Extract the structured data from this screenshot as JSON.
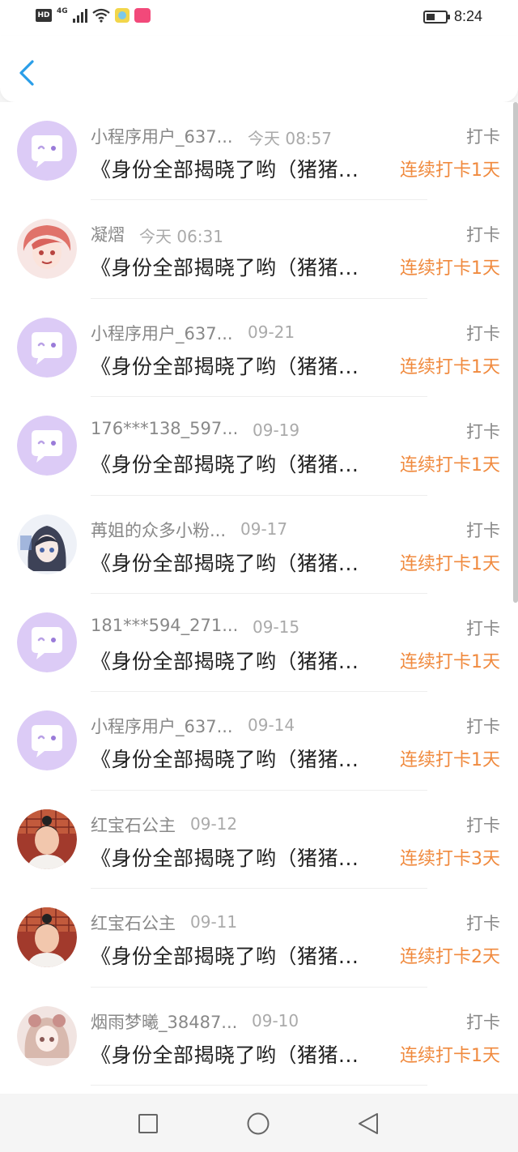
{
  "status_bar": {
    "hd": "HD",
    "network": "4G",
    "time": "8:24",
    "icons": [
      "hd-icon",
      "signal-icon",
      "wifi-icon",
      "app-notification-icon",
      "app-notification-icon-2",
      "battery-icon"
    ]
  },
  "header": {
    "back_icon": "chevron-left-icon",
    "accent": "#2a9ee8"
  },
  "colors": {
    "streak": "#f08a3e",
    "placeholder_avatar": "#d9c6f5"
  },
  "items": [
    {
      "name": "小程序用户_637...",
      "time": "今天 08:57",
      "title": "《身份全部揭晓了哟（猪猪...",
      "action": "打卡",
      "streak": "连续打卡1天",
      "avatar": "placeholder"
    },
    {
      "name": "凝熠",
      "time": "今天 06:31",
      "title": "《身份全部揭晓了哟（猪猪...",
      "action": "打卡",
      "streak": "连续打卡1天",
      "avatar": "anime-red"
    },
    {
      "name": "小程序用户_637...",
      "time": "09-21",
      "title": "《身份全部揭晓了哟（猪猪...",
      "action": "打卡",
      "streak": "连续打卡1天",
      "avatar": "placeholder"
    },
    {
      "name": "176***138_597...",
      "time": "09-19",
      "title": "《身份全部揭晓了哟（猪猪...",
      "action": "打卡",
      "streak": "连续打卡1天",
      "avatar": "placeholder"
    },
    {
      "name": "苒姐的众多小粉...",
      "time": "09-17",
      "title": "《身份全部揭晓了哟（猪猪...",
      "action": "打卡",
      "streak": "连续打卡1天",
      "avatar": "anime-blue"
    },
    {
      "name": "181***594_271...",
      "time": "09-15",
      "title": "《身份全部揭晓了哟（猪猪...",
      "action": "打卡",
      "streak": "连续打卡1天",
      "avatar": "placeholder"
    },
    {
      "name": "小程序用户_637...",
      "time": "09-14",
      "title": "《身份全部揭晓了哟（猪猪...",
      "action": "打卡",
      "streak": "连续打卡1天",
      "avatar": "placeholder"
    },
    {
      "name": "红宝石公主",
      "time": "09-12",
      "title": "《身份全部揭晓了哟（猪猪...",
      "action": "打卡",
      "streak": "连续打卡3天",
      "avatar": "photo"
    },
    {
      "name": "红宝石公主",
      "time": "09-11",
      "title": "《身份全部揭晓了哟（猪猪...",
      "action": "打卡",
      "streak": "连续打卡2天",
      "avatar": "photo"
    },
    {
      "name": "烟雨梦曦_38487...",
      "time": "09-10",
      "title": "《身份全部揭晓了哟（猪猪...",
      "action": "打卡",
      "streak": "连续打卡1天",
      "avatar": "anime-doll"
    }
  ],
  "nav_bar": {
    "icons": [
      "recent-apps-icon",
      "home-icon",
      "back-icon"
    ]
  }
}
